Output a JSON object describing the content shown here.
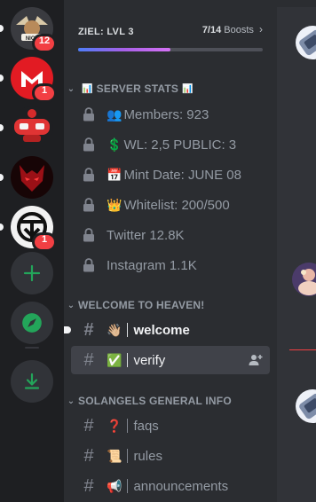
{
  "rail": {
    "servers": [
      {
        "name": "server-heaven",
        "badge": "12",
        "color": "#2f3034"
      },
      {
        "name": "server-red-m",
        "badge": "1",
        "color": "#e02020"
      },
      {
        "name": "server-mech",
        "badge": "",
        "color": "#c0262c"
      },
      {
        "name": "server-wolf",
        "badge": "",
        "color": "#1a0608"
      },
      {
        "name": "server-emblem",
        "badge": "1",
        "color": "#efefef"
      }
    ],
    "accent_green": "#23a55a"
  },
  "boost_goal": {
    "title": "ZIEL: LVL 3",
    "count": "7/14",
    "suffix": "Boosts",
    "progress": 0.5
  },
  "categories": [
    {
      "label": "SERVER STATS",
      "emoji": "📊"
    },
    {
      "label": "WELCOME TO HEAVEN!"
    },
    {
      "label": "SOLANGELS GENERAL INFO"
    }
  ],
  "stats": [
    {
      "emoji": "👥",
      "text": "Members: 923"
    },
    {
      "emoji": "💲",
      "text": "WL: 2,5 PUBLIC: 3"
    },
    {
      "emoji": "📅",
      "text": "Mint Date: JUNE 08"
    },
    {
      "emoji": "👑",
      "text": "Whitelist: 200/500"
    },
    {
      "emoji": "",
      "text": "Twitter 12.8K"
    },
    {
      "emoji": "",
      "text": "Instagram 1.1K"
    }
  ],
  "welcome_channels": [
    {
      "emoji": "👋🏼",
      "text": "welcome",
      "state": "unread"
    },
    {
      "emoji": "✅",
      "text": "verify",
      "state": "selected"
    }
  ],
  "info_channels": [
    {
      "emoji": "❓",
      "text": "faqs"
    },
    {
      "emoji": "📜",
      "text": "rules"
    },
    {
      "emoji": "📢",
      "text": "announcements"
    }
  ],
  "colors": {
    "rail_bg": "#1e1f22",
    "sidebar_bg": "#2b2d31",
    "chat_bg": "#313338",
    "selected_bg": "#404249",
    "badge_red": "#f23f43",
    "blurple": "#5865f2"
  }
}
